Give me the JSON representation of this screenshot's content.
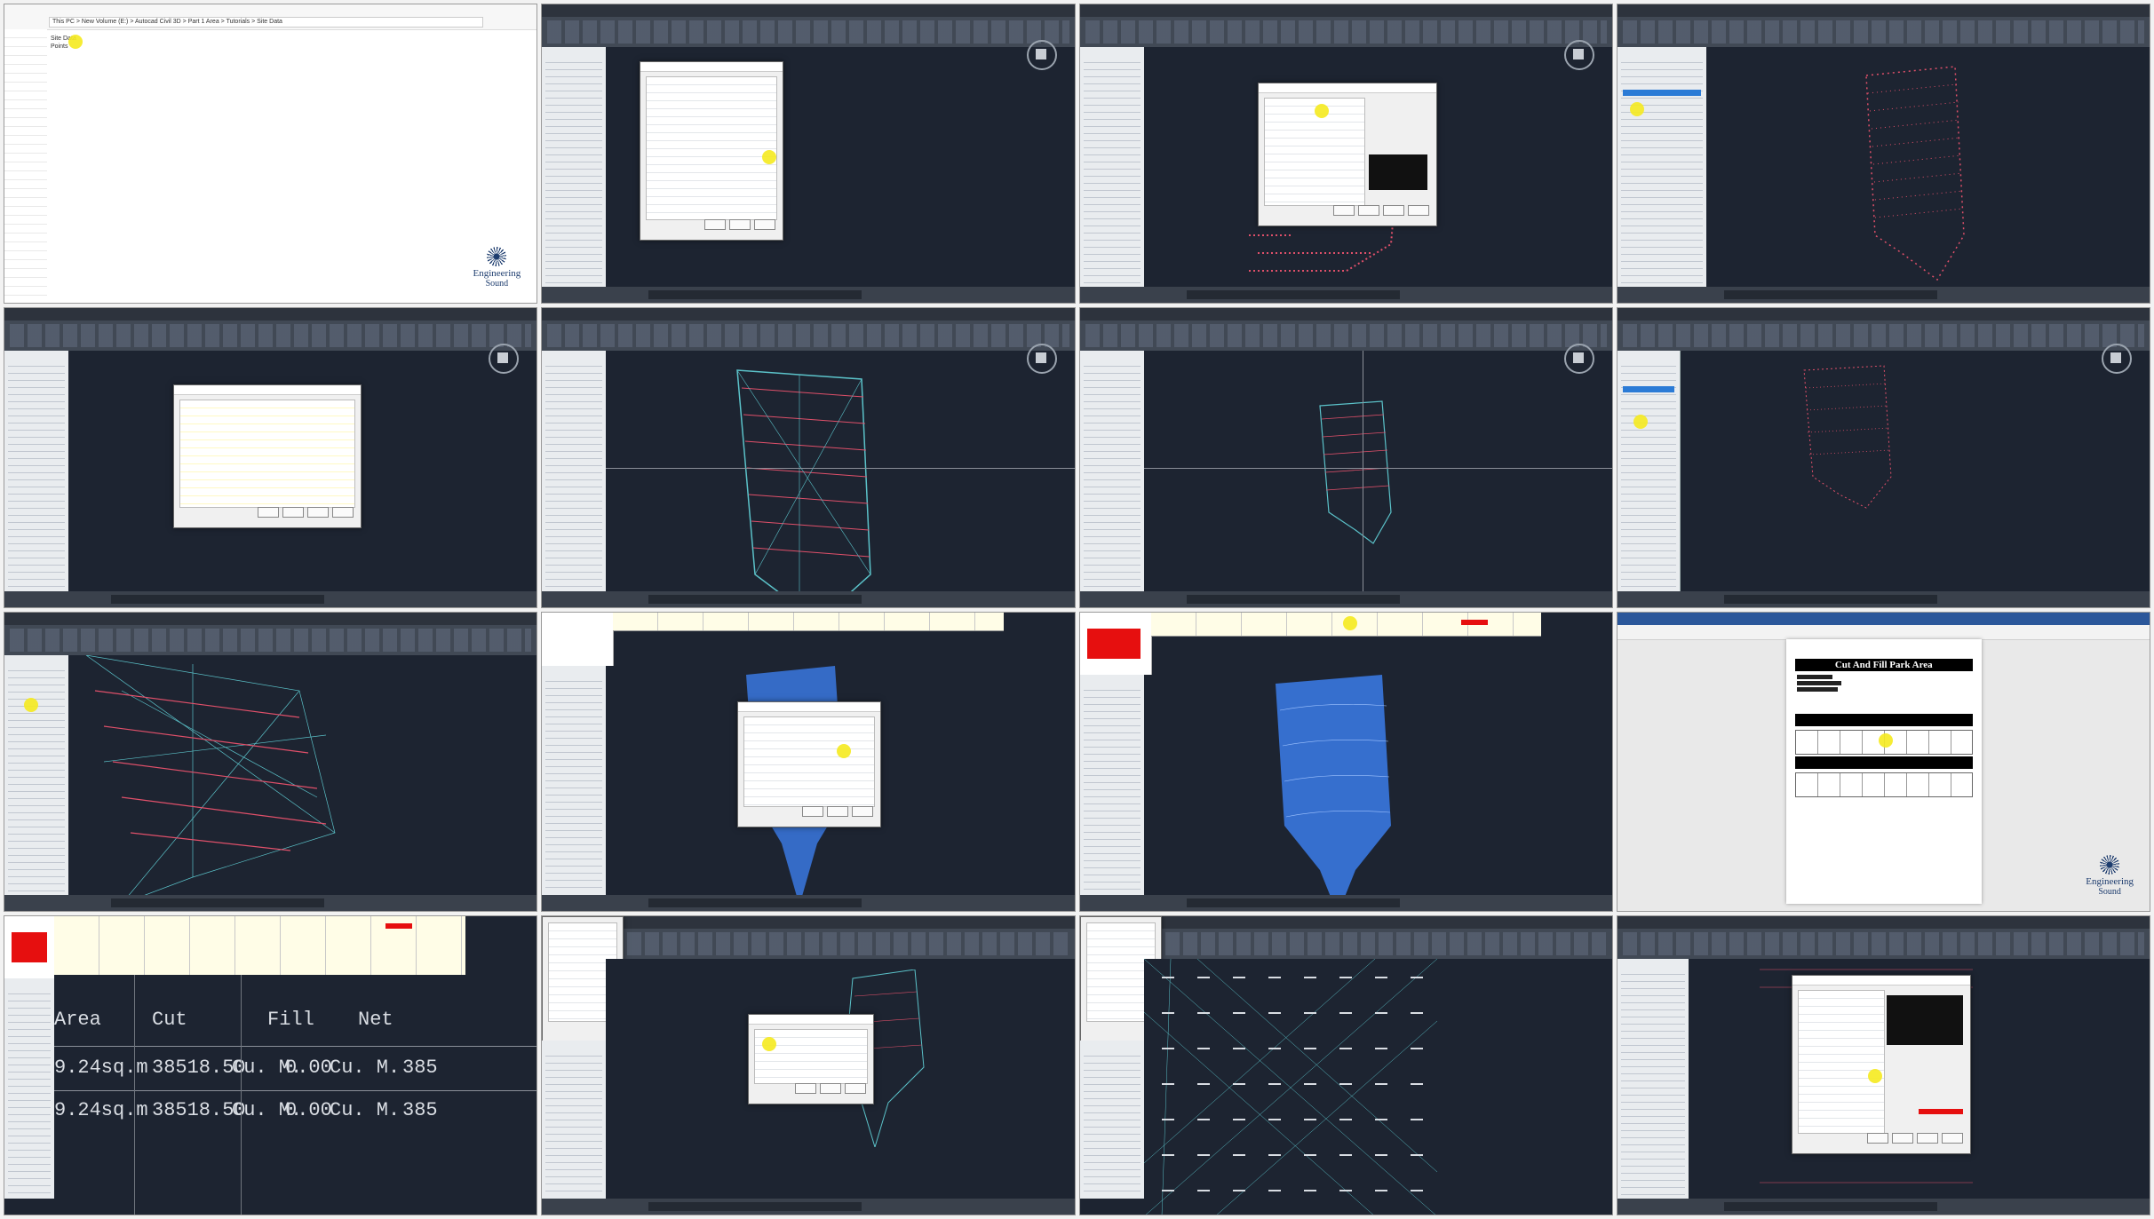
{
  "explorer": {
    "address": "This PC  >  New Volume (E:)  >  Autocad Civil 3D  >  Part 1 Area  >  Tutorials  >  Site Data",
    "files": [
      "Site Data",
      "Points"
    ]
  },
  "branding": {
    "line1": "Engineering",
    "line2": "Sound"
  },
  "report": {
    "title": "Cut And Fill Park Area"
  },
  "volume_table": {
    "headers": [
      "Area",
      "Cut",
      "Fill",
      "Net"
    ],
    "rows": [
      [
        "9.24sq.m",
        "38518.50",
        "Cu. M.",
        "0.00",
        "Cu. M.",
        "385"
      ],
      [
        "9.24sq.m",
        "38518.50",
        "Cu. M.",
        "0.00",
        "Cu. M.",
        "385"
      ]
    ]
  },
  "colors": {
    "civil_bg": "#1d2431",
    "points": "#e0506a",
    "surface_blue": "#3a78e0",
    "highlight": "#f5ea1f",
    "red_swatch": "#e60f0f"
  }
}
